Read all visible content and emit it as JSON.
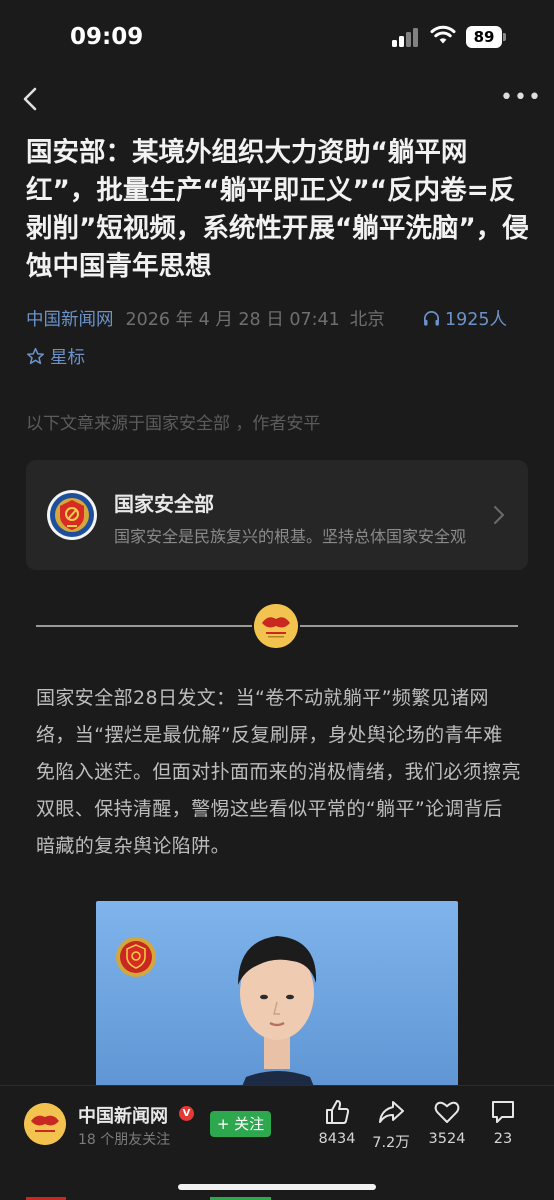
{
  "status_bar": {
    "time": "09:09",
    "battery": "89"
  },
  "article": {
    "title": "国安部：某境外组织大力资助“躺平网红”，批量生产“躺平即正义”“反内卷=反剥削”短视频，系统性开展“躺平洗脑”，侵蚀中国青年思想",
    "source": "中国新闻网",
    "date": "2026 年 4 月 28 日  07:41",
    "location": "北京",
    "listeners": "1925人",
    "star_label": "星标",
    "origin_note": "以下文章来源于国家安全部 ，作者安平",
    "body": "国家安全部28日发文：当“卷不动就躺平”频繁见诸网络，当“摆烂是最优解”反复刷屏，身处舆论场的青年难免陷入迷茫。但面对扑面而来的消极情绪，我们必须擦亮双眼、保持清醒，警惕这些看似平常的“躺平”论调背后暗藏的复杂舆论陷阱。"
  },
  "account_card": {
    "name": "国家安全部",
    "description": "国家安全是民族复兴的根基。坚持总体国家安全观"
  },
  "bottom_bar": {
    "publisher": "中国新闻网",
    "fans": "18 个朋友关注",
    "follow_label": "+ 关注",
    "likes": "8434",
    "shares": "7.2万",
    "favorites": "3524",
    "comments": "23"
  },
  "colors": {
    "background": "#1b1b1b",
    "link": "#6b93c9",
    "follow_green": "#2da84e",
    "verified_red": "#e53935"
  },
  "icons": [
    "back-arrow-icon",
    "more-icon",
    "headphones-icon",
    "star-icon",
    "chevron-right-icon",
    "thumbs-up-icon",
    "share-icon",
    "heart-icon",
    "comment-icon"
  ]
}
